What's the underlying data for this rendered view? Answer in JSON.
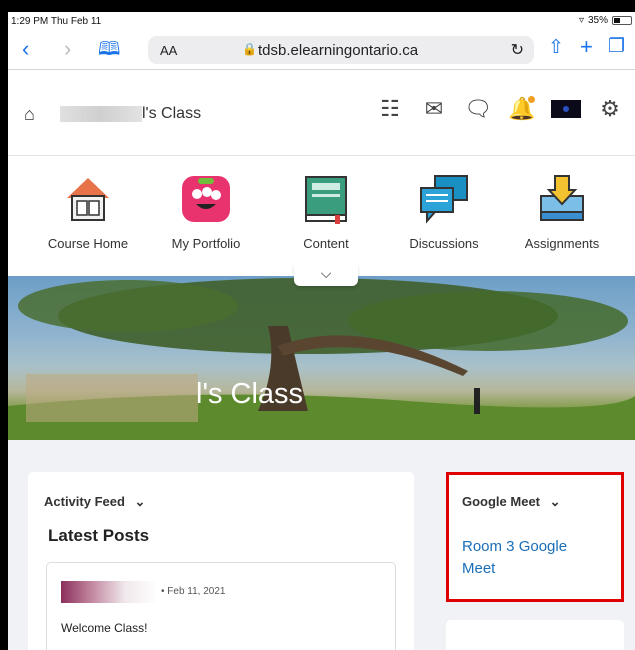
{
  "status": {
    "time": "1:29 PM  Thu Feb 11",
    "battery": "35%"
  },
  "browser": {
    "text_size": "AA",
    "url": "tdsb.elearningontario.ca"
  },
  "course": {
    "title": "l's Class"
  },
  "tools": [
    {
      "label": "Course Home",
      "icon": "house-book-icon"
    },
    {
      "label": "My Portfolio",
      "icon": "monster-icon"
    },
    {
      "label": "Content",
      "icon": "book-icon"
    },
    {
      "label": "Discussions",
      "icon": "chat-bubbles-icon"
    },
    {
      "label": "Assignments",
      "icon": "dropbox-tray-icon"
    }
  ],
  "banner": {
    "title": "l's Class"
  },
  "activity": {
    "widget_title": "Activity Feed",
    "heading": "Latest Posts",
    "post_date": "• Feb 11, 2021",
    "post_text": "Welcome Class!"
  },
  "meet": {
    "widget_title": "Google Meet",
    "link": "Room 3 Google Meet"
  },
  "colors": {
    "link": "#1a6db8",
    "highlight": "#e00000"
  }
}
